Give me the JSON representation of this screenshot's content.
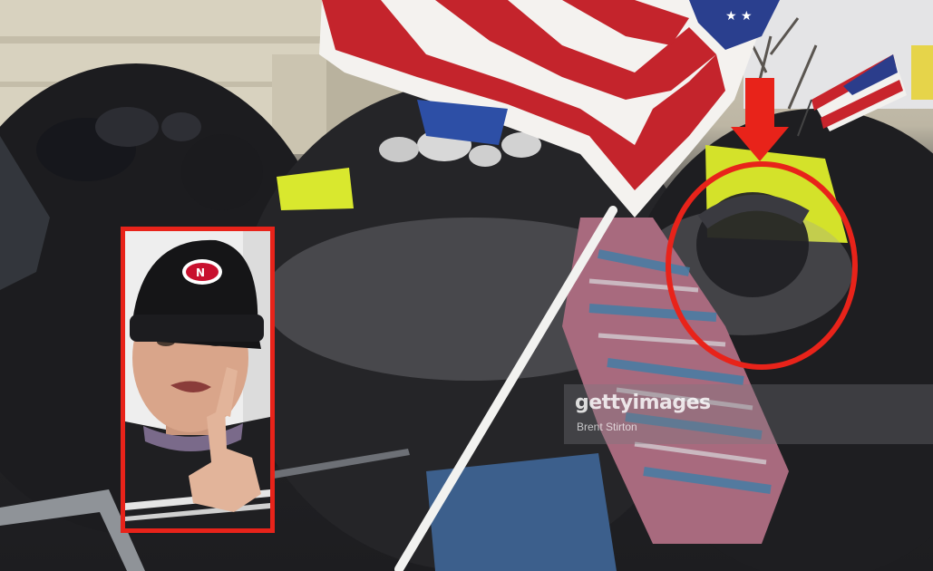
{
  "photo": {
    "watermark": {
      "brand": "gettyimages",
      "credit": "Brent Stirton"
    }
  },
  "annotations": {
    "highlight_color": "#e8231a",
    "inset_badge_icon": "team-logo-icon",
    "arrow_icon": "down-arrow-icon",
    "circle_icon": "highlight-circle"
  }
}
